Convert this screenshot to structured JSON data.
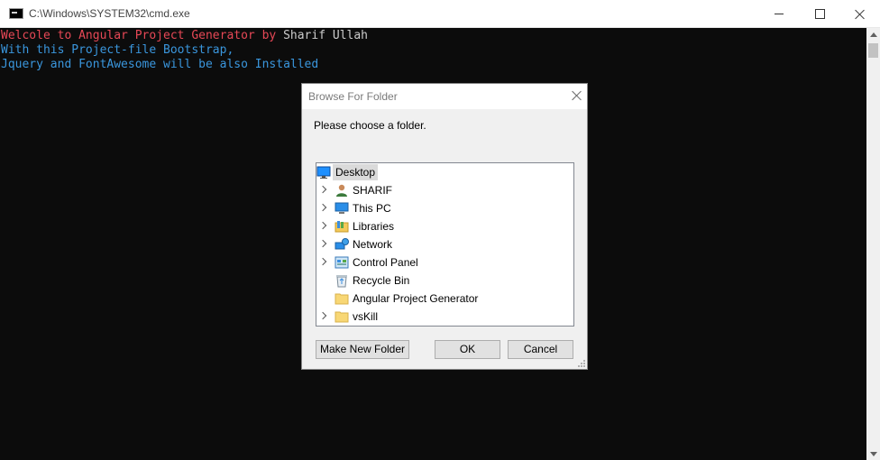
{
  "window": {
    "title": "C:\\Windows\\SYSTEM32\\cmd.exe"
  },
  "console": {
    "line1_red": "Welcole to Angular Project Generator by ",
    "line1_gray": "Sharif Ullah",
    "line2": "With this Project-file Bootstrap,",
    "line3": "Jquery and FontAwesome will be also Installed"
  },
  "dialog": {
    "title": "Browse For Folder",
    "prompt": "Please choose a folder.",
    "tree": {
      "root": {
        "label": "Desktop",
        "icon": "desktop-icon",
        "selected": true
      },
      "items": [
        {
          "label": "SHARIF",
          "icon": "user-icon",
          "expandable": true
        },
        {
          "label": "This PC",
          "icon": "computer-icon",
          "expandable": true
        },
        {
          "label": "Libraries",
          "icon": "libraries-icon",
          "expandable": true
        },
        {
          "label": "Network",
          "icon": "network-icon",
          "expandable": true
        },
        {
          "label": "Control Panel",
          "icon": "control-panel-icon",
          "expandable": true
        },
        {
          "label": "Recycle Bin",
          "icon": "recycle-bin-icon",
          "expandable": false
        },
        {
          "label": "Angular Project Generator",
          "icon": "folder-icon",
          "expandable": false
        },
        {
          "label": "vsKill",
          "icon": "folder-icon",
          "expandable": true
        }
      ]
    },
    "buttons": {
      "new_folder": "Make New Folder",
      "ok": "OK",
      "cancel": "Cancel"
    }
  },
  "colors": {
    "console_bg": "#0c0c0c",
    "console_red": "#e74856",
    "console_blue": "#3a96dd",
    "console_gray": "#cccccc",
    "selection": "#dadada"
  }
}
